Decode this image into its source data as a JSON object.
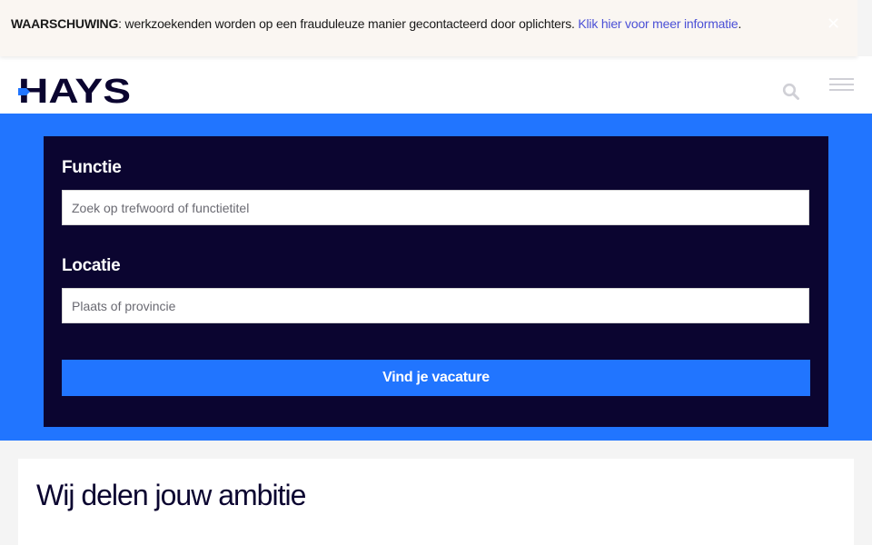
{
  "warning": {
    "label": "WAARSCHUWING",
    "message": ": werkzoekenden worden op een frauduleuze manier gecontacteerd door oplichters. ",
    "link": "Klik hier voor meer informatie",
    "suffix": ".",
    "close_symbol": "✕"
  },
  "header": {
    "logo_text": "HAYS",
    "icons": [
      "search-icon",
      "hamburger-menu-icon"
    ]
  },
  "search_form": {
    "job_label": "Functie",
    "job_placeholder": "Zoek op trefwoord of functietitel",
    "job_value": "",
    "location_label": "Locatie",
    "location_placeholder": "Plaats of provincie",
    "location_value": "",
    "submit_label": "Vind je vacature"
  },
  "content": {
    "heading": "Wij delen jouw ambitie"
  },
  "colors": {
    "brand_navy": "#0b0530",
    "brand_blue": "#2175ff",
    "link_purple": "#4b50d6",
    "warning_bg": "#faf6f2"
  }
}
